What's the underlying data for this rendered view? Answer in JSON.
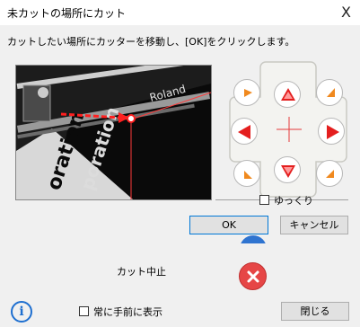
{
  "window": {
    "title": "未カットの場所にカット",
    "close_glyph": "X"
  },
  "instruction": "カットしたい場所にカッターを移動し、[OK]をクリックします。",
  "camera": {
    "labels": [
      "oration",
      "poration"
    ],
    "brand": "Roland"
  },
  "options": {
    "slow_label": "ゆっくり",
    "stay_on_top_label": "常に手前に表示"
  },
  "buttons": {
    "ok": "OK",
    "cancel": "キャンセル",
    "close": "閉じる",
    "info_glyph": "i"
  },
  "cut_stop_label": "カット中止",
  "colors": {
    "arrow_orange": "#f0891e",
    "arrow_red": "#e41e1e",
    "stop_red": "#e64646",
    "info_blue": "#1e6fd0"
  }
}
